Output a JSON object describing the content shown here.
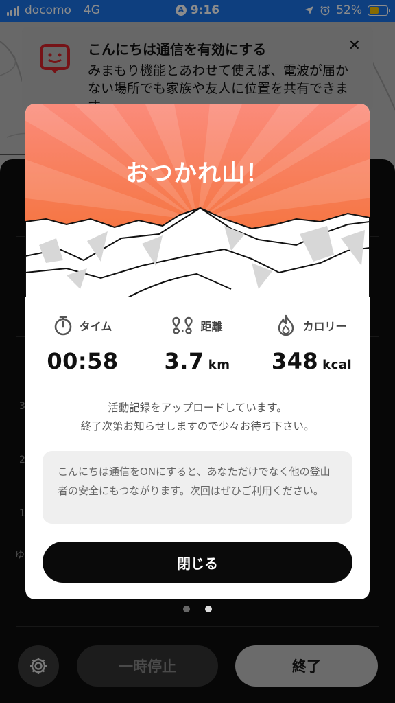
{
  "status_bar": {
    "carrier": "docomo",
    "network": "4G",
    "time": "9:16",
    "battery_percent": "52%",
    "battery_level": 0.52,
    "colors": {
      "background": "#1a73e8",
      "battery": "#f7c400"
    }
  },
  "banner": {
    "title": "こんにちは通信を有効にする",
    "body": "みまもり機能とあわせて使えば、電波が届かない場所でも家族や友人に位置を共有できます。",
    "close_icon": "close-icon"
  },
  "dark_panel": {
    "side_labels": [
      "3",
      "2",
      "1",
      "ゆ"
    ],
    "page_dots": {
      "count": 2,
      "active_index": 1
    },
    "pause_label": "一時停止",
    "end_label": "終了"
  },
  "modal": {
    "title": "おつかれ山！",
    "colors": {
      "hero_top": "#fa8a78",
      "hero_bottom": "#f36f2b",
      "button": "#0a0a0a"
    },
    "stats": [
      {
        "icon": "stopwatch-icon",
        "label": "タイム",
        "value": "00:58",
        "unit": ""
      },
      {
        "icon": "route-icon",
        "label": "距離",
        "value": "3.7",
        "unit": "km"
      },
      {
        "icon": "flame-icon",
        "label": "カロリー",
        "value": "348",
        "unit": "kcal"
      }
    ],
    "upload_line1": "活動記録をアップロードしています。",
    "upload_line2": "終了次第お知らせしますので少々お待ち下さい。",
    "info_text": "こんにちは通信をONにすると、あなただけでなく他の登山者の安全にもつながります。次回はぜひご利用ください。",
    "close_button": "閉じる"
  }
}
